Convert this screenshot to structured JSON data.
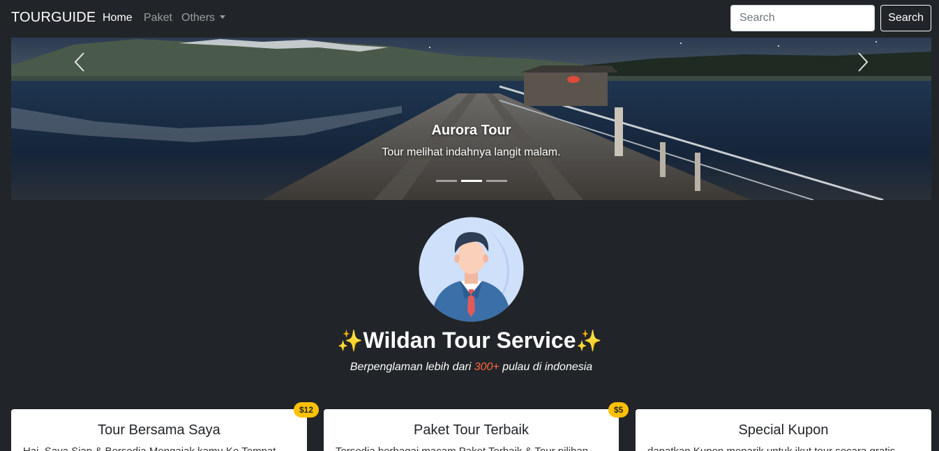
{
  "navbar": {
    "brand": "TOURGUIDE",
    "links": [
      {
        "label": "Home"
      },
      {
        "label": "Paket"
      },
      {
        "label": "Others"
      }
    ],
    "search_placeholder": "Search",
    "search_button": "Search"
  },
  "carousel": {
    "caption_title": "Aurora Tour",
    "caption_text": "Tour melihat indahnya langit malam.",
    "slide_count": 3,
    "active_slide": 2
  },
  "profile": {
    "title": "Wildan Tour Service",
    "sparkle": "✨",
    "subtitle_before": "Berpenglaman lebih dari ",
    "subtitle_highlight": "300+",
    "subtitle_after": " pulau di indonesia"
  },
  "cards": [
    {
      "title": "Tour Bersama Saya",
      "text": "Hai, Saya Siap & Bersedia Mengajak kamu Ke Tempat",
      "badge": "$12"
    },
    {
      "title": "Paket Tour Terbaik",
      "text": "Tersedia berbagai macam Paket Terbaik & Tour pilihan",
      "badge": "$5"
    },
    {
      "title": "Special Kupon",
      "text": "dapatkan Kupon menarik untuk ikut tour secara gratis",
      "badge": ""
    }
  ],
  "colors": {
    "background": "#212529",
    "badge": "#ffc107",
    "highlight": "#ff6a3d"
  }
}
